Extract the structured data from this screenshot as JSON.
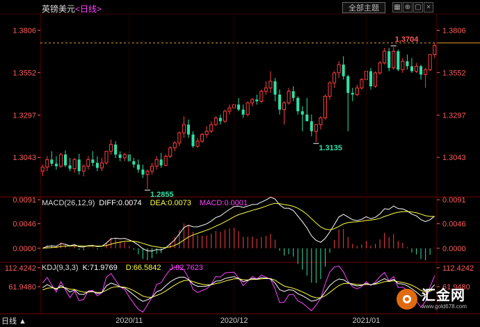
{
  "header": {
    "title": "英镑美元",
    "period": "<日线>",
    "theme_button": "全部主题",
    "icons": [
      "grid-icon",
      "pin-icon",
      "maximize-icon",
      "close-icon"
    ]
  },
  "colors": {
    "up": "#ff3f3f",
    "down": "#2ee0a8",
    "diff": "#ffffff",
    "dea": "#ffff44",
    "k": "#ffffff",
    "d": "#ffff44",
    "j": "#ff44ff",
    "axis_text": "#ff5a5a",
    "grid": "#5a0000"
  },
  "corner_label": "日线",
  "chart_data": [
    {
      "type": "candlestick",
      "panel": "price",
      "yticks": [
        "1.3806",
        "1.3552",
        "1.3297",
        "1.3043"
      ],
      "ylim": [
        1.281,
        1.39
      ],
      "last_price": 1.373,
      "annotations": [
        {
          "label": "1.3704",
          "value": 1.3704,
          "index": 77
        },
        {
          "label": "1.3135",
          "value": 1.3135,
          "index": 60
        },
        {
          "label": "1.2855",
          "value": 1.2855,
          "index": 23
        }
      ],
      "x_labels": [
        {
          "label": "2020/11",
          "index": 19
        },
        {
          "label": "2020/12",
          "index": 42
        },
        {
          "label": "2021/01",
          "index": 71
        }
      ],
      "ohlc": [
        [
          1.296,
          1.3,
          1.293,
          1.2985
        ],
        [
          1.2985,
          1.305,
          1.296,
          1.303
        ],
        [
          1.303,
          1.308,
          1.299,
          1.3005
        ],
        [
          1.3005,
          1.305,
          1.297,
          1.299
        ],
        [
          1.299,
          1.307,
          1.298,
          1.306
        ],
        [
          1.306,
          1.3085,
          1.2985,
          1.2995
        ],
        [
          1.2995,
          1.304,
          1.296,
          1.2975
        ],
        [
          1.2975,
          1.304,
          1.295,
          1.303
        ],
        [
          1.303,
          1.3065,
          1.294,
          1.296
        ],
        [
          1.296,
          1.3,
          1.293,
          1.299
        ],
        [
          1.299,
          1.305,
          1.297,
          1.303
        ],
        [
          1.303,
          1.308,
          1.299,
          1.301
        ],
        [
          1.301,
          1.305,
          1.296,
          1.298
        ],
        [
          1.298,
          1.304,
          1.296,
          1.301
        ],
        [
          1.301,
          1.308,
          1.3,
          1.308
        ],
        [
          1.308,
          1.315,
          1.306,
          1.312
        ],
        [
          1.312,
          1.314,
          1.304,
          1.306
        ],
        [
          1.306,
          1.308,
          1.302,
          1.304
        ],
        [
          1.304,
          1.307,
          1.302,
          1.306
        ],
        [
          1.306,
          1.308,
          1.301,
          1.302
        ],
        [
          1.302,
          1.304,
          1.298,
          1.3
        ],
        [
          1.3,
          1.303,
          1.295,
          1.297
        ],
        [
          1.297,
          1.3,
          1.292,
          1.294
        ],
        [
          1.294,
          1.297,
          1.2855,
          1.296
        ],
        [
          1.296,
          1.301,
          1.294,
          1.299
        ],
        [
          1.299,
          1.305,
          1.297,
          1.303
        ],
        [
          1.303,
          1.307,
          1.298,
          1.2995
        ],
        [
          1.2995,
          1.306,
          1.299,
          1.305
        ],
        [
          1.305,
          1.311,
          1.304,
          1.31
        ],
        [
          1.31,
          1.314,
          1.308,
          1.313
        ],
        [
          1.313,
          1.32,
          1.311,
          1.319
        ],
        [
          1.319,
          1.329,
          1.316,
          1.324
        ],
        [
          1.324,
          1.327,
          1.316,
          1.318
        ],
        [
          1.318,
          1.32,
          1.31,
          1.311
        ],
        [
          1.311,
          1.316,
          1.31,
          1.314
        ],
        [
          1.314,
          1.319,
          1.313,
          1.318
        ],
        [
          1.318,
          1.323,
          1.316,
          1.32
        ],
        [
          1.32,
          1.326,
          1.319,
          1.324
        ],
        [
          1.324,
          1.329,
          1.323,
          1.328
        ],
        [
          1.328,
          1.33,
          1.324,
          1.326
        ],
        [
          1.326,
          1.333,
          1.325,
          1.332
        ],
        [
          1.332,
          1.336,
          1.33,
          1.334
        ],
        [
          1.334,
          1.338,
          1.33,
          1.336
        ],
        [
          1.336,
          1.34,
          1.332,
          1.333
        ],
        [
          1.333,
          1.336,
          1.328,
          1.33
        ],
        [
          1.33,
          1.338,
          1.329,
          1.337
        ],
        [
          1.337,
          1.34,
          1.335,
          1.339
        ],
        [
          1.339,
          1.342,
          1.336,
          1.338
        ],
        [
          1.338,
          1.345,
          1.337,
          1.344
        ],
        [
          1.344,
          1.35,
          1.342,
          1.346
        ],
        [
          1.346,
          1.356,
          1.343,
          1.35
        ],
        [
          1.35,
          1.352,
          1.338,
          1.342
        ],
        [
          1.342,
          1.345,
          1.33,
          1.333
        ],
        [
          1.333,
          1.338,
          1.324,
          1.337
        ],
        [
          1.337,
          1.346,
          1.336,
          1.344
        ],
        [
          1.344,
          1.347,
          1.338,
          1.34
        ],
        [
          1.34,
          1.341,
          1.33,
          1.332
        ],
        [
          1.332,
          1.335,
          1.32,
          1.33
        ],
        [
          1.33,
          1.34,
          1.326,
          1.326
        ],
        [
          1.326,
          1.33,
          1.317,
          1.32
        ],
        [
          1.32,
          1.324,
          1.3135,
          1.324
        ],
        [
          1.324,
          1.329,
          1.321,
          1.328
        ],
        [
          1.328,
          1.342,
          1.327,
          1.341
        ],
        [
          1.341,
          1.35,
          1.339,
          1.349
        ],
        [
          1.349,
          1.356,
          1.346,
          1.355
        ],
        [
          1.355,
          1.362,
          1.352,
          1.36
        ],
        [
          1.36,
          1.365,
          1.351,
          1.353
        ],
        [
          1.353,
          1.354,
          1.32,
          1.343
        ],
        [
          1.343,
          1.346,
          1.338,
          1.342
        ],
        [
          1.342,
          1.348,
          1.341,
          1.346
        ],
        [
          1.346,
          1.352,
          1.345,
          1.351
        ],
        [
          1.351,
          1.358,
          1.348,
          1.356
        ],
        [
          1.356,
          1.358,
          1.345,
          1.347
        ],
        [
          1.347,
          1.356,
          1.346,
          1.355
        ],
        [
          1.355,
          1.362,
          1.354,
          1.361
        ],
        [
          1.361,
          1.37,
          1.36,
          1.368
        ],
        [
          1.368,
          1.37,
          1.356,
          1.358
        ],
        [
          1.358,
          1.3704,
          1.357,
          1.368
        ],
        [
          1.368,
          1.369,
          1.356,
          1.357
        ],
        [
          1.357,
          1.364,
          1.355,
          1.362
        ],
        [
          1.362,
          1.366,
          1.357,
          1.359
        ],
        [
          1.359,
          1.364,
          1.355,
          1.356
        ],
        [
          1.356,
          1.361,
          1.355,
          1.359
        ],
        [
          1.359,
          1.36,
          1.351,
          1.354
        ],
        [
          1.354,
          1.358,
          1.346,
          1.357
        ],
        [
          1.357,
          1.366,
          1.356,
          1.366
        ],
        [
          1.366,
          1.373,
          1.364,
          1.3715
        ]
      ]
    },
    {
      "type": "macd",
      "panel": "macd",
      "title": "MACD(26,12,9)",
      "readout": {
        "DIFF": "0.0074",
        "DEA": "0.0073",
        "MACD": "0.0001"
      },
      "yticks": [
        "0.0091",
        "0.0046",
        "0.0000"
      ],
      "ylim": [
        -0.0025,
        0.0095
      ]
    },
    {
      "type": "kdj",
      "panel": "kdj",
      "title": "KDJ(9,3,3)",
      "readout": {
        "K": "71.9769",
        "D": "66.5842",
        "J": "82.7623"
      },
      "yticks": [
        "112.4242",
        "61.9480"
      ],
      "ylim": [
        -10,
        125
      ]
    }
  ]
}
